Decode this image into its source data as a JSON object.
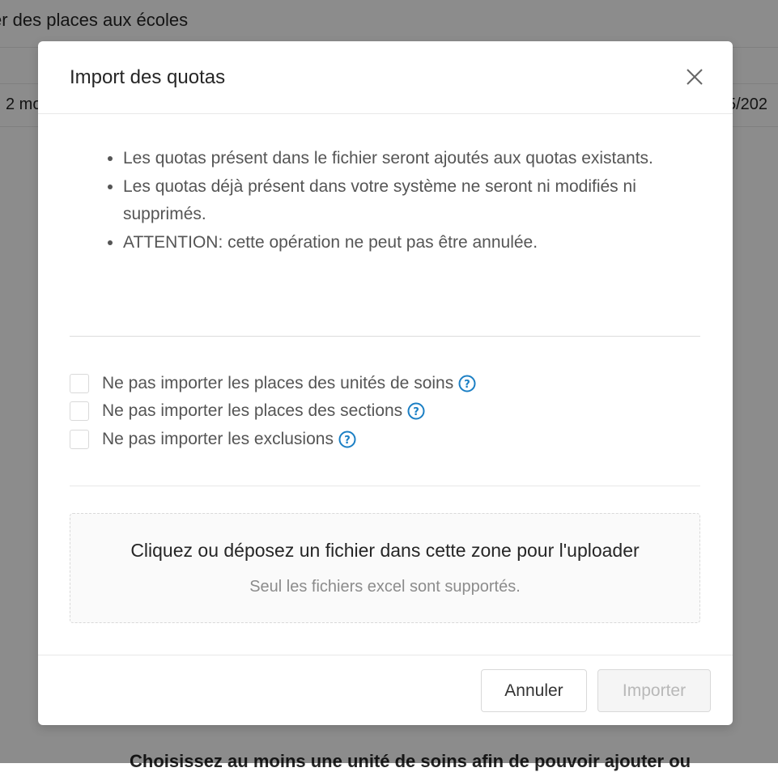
{
  "background": {
    "page_title": "er des places aux écoles",
    "row_left_text": "2 mo",
    "row_right_text": "5/202",
    "bottom_text": "Choisissez au moins une unité de soins afin de pouvoir ajouter ou"
  },
  "modal": {
    "title": "Import des quotas",
    "info_items": [
      "Les quotas présent dans le fichier seront ajoutés aux quotas existants.",
      "Les quotas déjà présent dans votre système ne seront ni modifiés ni supprimés.",
      "ATTENTION: cette opération ne peut pas être annulée."
    ],
    "options": [
      {
        "label": "Ne pas importer les places des unités de soins",
        "checked": false
      },
      {
        "label": "Ne pas importer les places des sections",
        "checked": false
      },
      {
        "label": "Ne pas importer les exclusions",
        "checked": false
      }
    ],
    "dropzone": {
      "title": "Cliquez ou déposez un fichier dans cette zone pour l'uploader",
      "hint": "Seul les fichiers excel sont supportés."
    },
    "footer": {
      "cancel_label": "Annuler",
      "import_label": "Importer"
    }
  },
  "colors": {
    "help_icon": "#1b7fc4",
    "overlay": "rgba(0,0,0,0.45)",
    "disabled_text": "#b8b8b8"
  },
  "icons": {
    "close": "close-icon",
    "help": "question-circle-icon"
  }
}
